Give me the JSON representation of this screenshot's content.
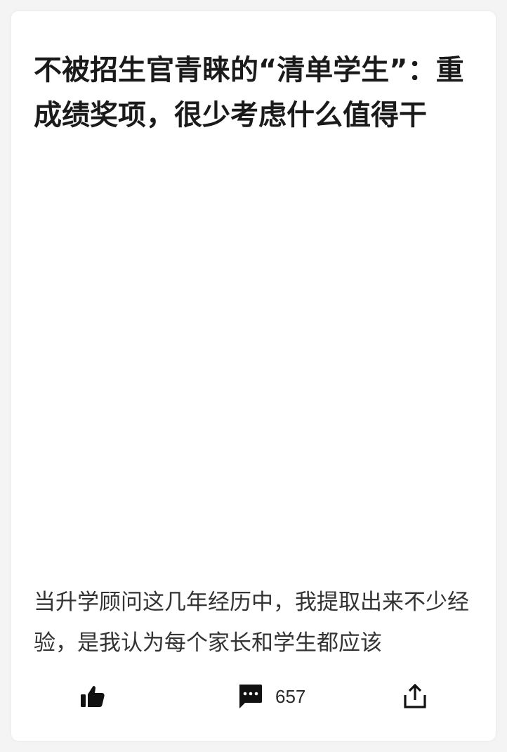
{
  "article": {
    "title": "不被招生官青睐的“清单学生”：重成绩奖项，很少考虑什么值得干",
    "excerpt": "当升学顾问这几年经历中，我提取出来不少经验，是我认为每个家长和学生都应该"
  },
  "actions": {
    "like_icon": "thumbs-up-icon",
    "comment_icon": "comment-bubble-icon",
    "comment_count": "657",
    "share_icon": "share-upload-icon"
  },
  "colors": {
    "background": "#f4f4f4",
    "card": "#ffffff",
    "title_text": "#1a1a1a",
    "body_text": "#333333"
  }
}
